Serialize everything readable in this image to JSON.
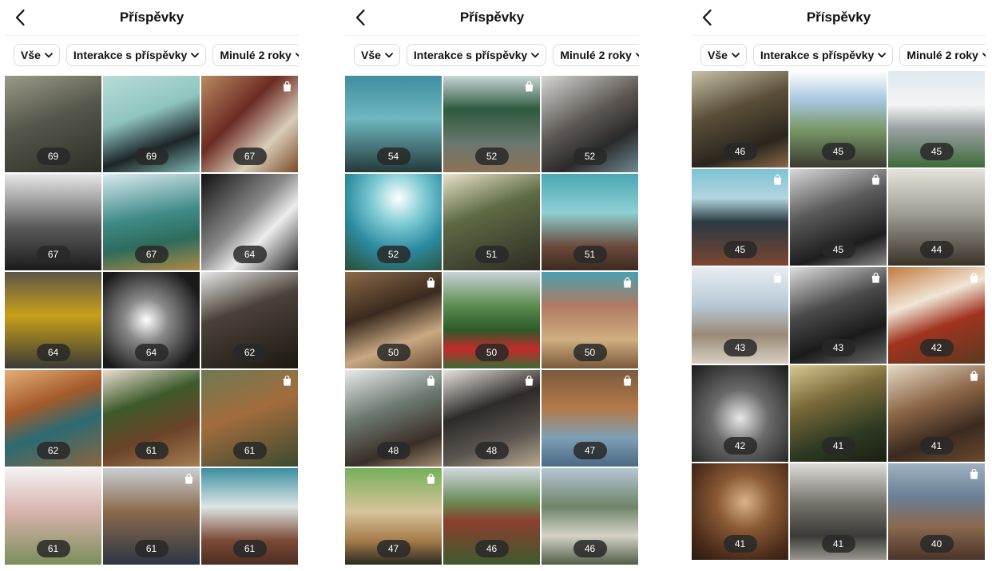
{
  "panels": [
    {
      "title": "Příspěvky",
      "filters": [
        "Vše",
        "Interakce s příspěvky",
        "Minulé 2 roky"
      ],
      "tiles": [
        {
          "label": "69",
          "shop": false,
          "bg": "linear-gradient(160deg,#9a9a88 0%,#55574a 45%,#2d2f27 100%)"
        },
        {
          "label": "69",
          "shop": false,
          "bg": "linear-gradient(160deg,#b9dcd6 0%,#8fc5bf 40%,#1c2628 70%,#7fb8b1 100%)"
        },
        {
          "label": "67",
          "shop": true,
          "bg": "linear-gradient(135deg,#b98b63 0%,#6b2b22 40%,#d9cdb8 70%,#7a4a2a 100%)"
        },
        {
          "label": "67",
          "shop": false,
          "bg": "linear-gradient(180deg,#e8e8e8 0%,#5b5b5b 55%,#1b1b1b 100%)"
        },
        {
          "label": "67",
          "shop": false,
          "bg": "linear-gradient(170deg,#d9eaf0 0%,#3e8a86 45%,#2e6b5c 70%,#b08a45 100%)"
        },
        {
          "label": "64",
          "shop": false,
          "bg": "linear-gradient(135deg,#111 0%,#888 45%,#ededed 65%,#222 100%)"
        },
        {
          "label": "64",
          "shop": false,
          "bg": "linear-gradient(180deg,#5d5548 0%,#c7a01a 45%,#3a3a36 100%)"
        },
        {
          "label": "64",
          "shop": false,
          "bg": "radial-gradient(circle at 45% 50%,#ffffff 0%,#8a8a8a 30%,#1a1a1a 80%)"
        },
        {
          "label": "62",
          "shop": false,
          "bg": "linear-gradient(160deg,#e7e7e7 0%,#4a4238 40%,#1c1712 100%)"
        },
        {
          "label": "62",
          "shop": false,
          "bg": "linear-gradient(160deg,#e4b07a 0%,#a55a2a 35%,#2c6b72 60%,#8a6540 100%)"
        },
        {
          "label": "61",
          "shop": false,
          "bg": "linear-gradient(160deg,#e9ddd0 0%,#3c5a2a 35%,#6a4328 65%,#a57e55 100%)"
        },
        {
          "label": "61",
          "shop": true,
          "bg": "linear-gradient(160deg,#6e7a52 0%,#a26c3d 45%,#3b4a30 100%)"
        },
        {
          "label": "61",
          "shop": false,
          "bg": "linear-gradient(180deg,#f2f2f2 0%,#d8b3ad 45%,#7a8f5a 100%)"
        },
        {
          "label": "61",
          "shop": true,
          "bg": "linear-gradient(180deg,#c9ced2 0%,#8b6a4c 45%,#2c3644 100%)"
        },
        {
          "label": "61",
          "shop": false,
          "bg": "linear-gradient(180deg,#3b8ea0 0%,#dde6e4 40%,#7a4a36 75%,#4e2d22 100%)"
        }
      ]
    },
    {
      "title": "Příspěvky",
      "filters": [
        "Vše",
        "Interakce s příspěvky",
        "Minulé 2 roky"
      ],
      "tiles": [
        {
          "label": "54",
          "shop": false,
          "bg": "linear-gradient(180deg,#3f8fa0 0%,#6fb6c0 45%,#243a3a 100%)"
        },
        {
          "label": "52",
          "shop": true,
          "bg": "linear-gradient(180deg,#c9d6d7 0%,#2e5a3e 35%,#6a786e 70%,#8c7156 100%)"
        },
        {
          "label": "52",
          "shop": false,
          "bg": "linear-gradient(150deg,#d6d6d3 0%,#5c5652 45%,#2a2a2a 70%,#6e8b92 100%)"
        },
        {
          "label": "52",
          "shop": false,
          "bg": "radial-gradient(circle at 55% 25%,#ffffff 0%,#7ccad3 30%,#2c8aa0 60%,#2a4d30 100%)"
        },
        {
          "label": "51",
          "shop": false,
          "bg": "linear-gradient(160deg,#e9e1c9 0%,#5d6a43 40%,#2e2b24 100%)"
        },
        {
          "label": "51",
          "shop": false,
          "bg": "linear-gradient(180deg,#4aa7b3 0%,#8ed0d3 40%,#6b4a3a 75%,#3d2a22 100%)"
        },
        {
          "label": "50",
          "shop": true,
          "bg": "linear-gradient(160deg,#8a6a48 0%,#3a2a1e 40%,#c9a983 70%,#6e4b30 100%)"
        },
        {
          "label": "50",
          "shop": false,
          "bg": "linear-gradient(180deg,#c8d2d8 0%,#5c8c4e 35%,#2d5a2a 60%,#c42a2a 80%,#3c6a35 100%)"
        },
        {
          "label": "50",
          "shop": true,
          "bg": "linear-gradient(180deg,#4aa0b0 0%,#b07a62 35%,#cfae82 70%,#7a5a3a 100%)"
        },
        {
          "label": "48",
          "shop": true,
          "bg": "linear-gradient(160deg,#e8ebec 0%,#6e7b72 40%,#3a2e28 75%,#a08c70 100%)"
        },
        {
          "label": "48",
          "shop": true,
          "bg": "linear-gradient(160deg,#e7e4de 0%,#2e2a28 40%,#5a5550 70%,#b8a892 100%)"
        },
        {
          "label": "47",
          "shop": true,
          "bg": "linear-gradient(180deg,#7a5a3e 0%,#b57a4a 40%,#7e9fb4 70%,#4a6a86 100%)"
        },
        {
          "label": "47",
          "shop": true,
          "bg": "linear-gradient(180deg,#74b05a 0%,#d8c49a 45%,#a67c4a 75%,#2a2a22 100%)"
        },
        {
          "label": "46",
          "shop": false,
          "bg": "linear-gradient(180deg,#cfd8dd 0%,#6a8a55 35%,#8b3f2e 55%,#3e5a2e 100%)"
        },
        {
          "label": "46",
          "shop": false,
          "bg": "linear-gradient(180deg,#b6c6d6 0%,#6e8468 40%,#d6d2c8 70%,#4e5e46 100%)"
        }
      ]
    },
    {
      "title": "Příspěvky",
      "filters": [
        "Vše",
        "Interakce s příspěvky",
        "Minulé 2 roky"
      ],
      "tiles": [
        {
          "label": "46",
          "shop": false,
          "bg": "linear-gradient(160deg,#c7c2a8 0%,#5a4e38 40%,#2a261e 75%,#8a6a45 100%)"
        },
        {
          "label": "45",
          "shop": false,
          "bg": "linear-gradient(180deg,#ffffff 0%,#a7c7e0 30%,#7a9a6a 60%,#3a3a2e 100%)"
        },
        {
          "label": "45",
          "shop": false,
          "bg": "linear-gradient(180deg,#dfe9f0 0%,#f4f4f4 35%,#9aa0a2 60%,#3d6a3a 100%)"
        },
        {
          "label": "45",
          "shop": true,
          "bg": "linear-gradient(180deg,#7cc3d4 0%,#b3d6df 30%,#2a3a42 55%,#7a4630 100%)"
        },
        {
          "label": "45",
          "shop": true,
          "bg": "linear-gradient(160deg,#d8d8d8 0%,#5a5a5a 40%,#1d1d1d 75%,#8a8a8a 100%)"
        },
        {
          "label": "44",
          "shop": false,
          "bg": "linear-gradient(180deg,#e6e3dc 0%,#a29f94 45%,#3a3228 100%)"
        },
        {
          "label": "43",
          "shop": true,
          "bg": "linear-gradient(180deg,#e8eef2 0%,#b7c8d6 40%,#9a8a76 70%,#d8cfc2 100%)"
        },
        {
          "label": "43",
          "shop": true,
          "bg": "linear-gradient(160deg,#dedede 0%,#4a4a4a 40%,#1a1a1a 70%,#6a6a6a 100%)"
        },
        {
          "label": "42",
          "shop": true,
          "bg": "linear-gradient(160deg,#c27a3e 0%,#f0e6d6 35%,#a0331e 60%,#5a3a22 100%)"
        },
        {
          "label": "42",
          "shop": false,
          "bg": "radial-gradient(circle at 50% 55%,#e8e8e8 0%,#6a6a6a 40%,#1a1a1a 100%)"
        },
        {
          "label": "41",
          "shop": false,
          "bg": "linear-gradient(160deg,#d8c890 0%,#7a6a3a 35%,#2e3a22 70%,#1a1e14 100%)"
        },
        {
          "label": "41",
          "shop": true,
          "bg": "linear-gradient(160deg,#e6dac4 0%,#8a6446 40%,#3a2a20 70%,#6a4a2e 100%)"
        },
        {
          "label": "41",
          "shop": false,
          "bg": "radial-gradient(circle at 55% 40%,#d9b48a 0%,#8a5a34 35%,#4a2a1a 75%,#2a1a10 100%)"
        },
        {
          "label": "41",
          "shop": false,
          "bg": "linear-gradient(180deg,#dcdcd8 0%,#7a7670 40%,#3a3a36 75%,#9a968e 100%)"
        },
        {
          "label": "40",
          "shop": true,
          "bg": "linear-gradient(180deg,#9fb2c2 0%,#6a7f94 35%,#8a6a50 65%,#4a3428 100%)"
        }
      ]
    }
  ]
}
